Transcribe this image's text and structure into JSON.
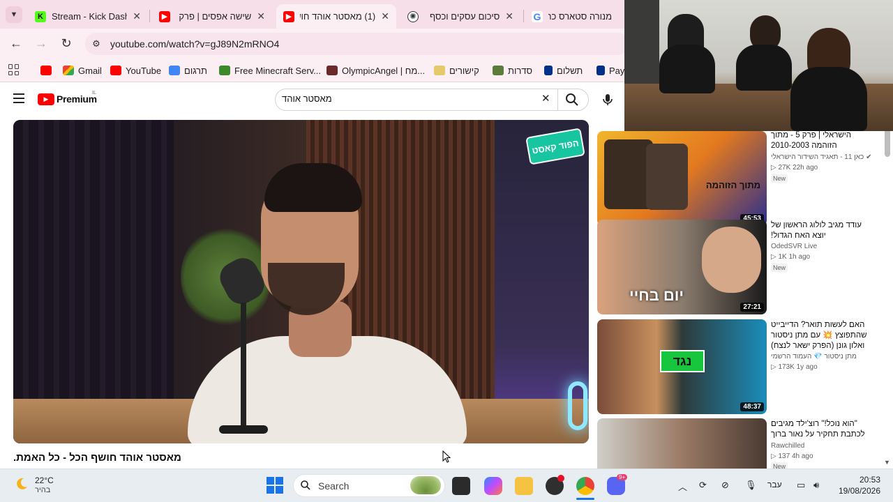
{
  "browser": {
    "tabs": [
      {
        "title": "Stream - Kick Dashb",
        "favicon": "kick-icon",
        "color": "#53fc18"
      },
      {
        "title": "שישה אפסים | פרק",
        "favicon": "youtube-icon",
        "color": "#ff0000"
      },
      {
        "title": "(1) מאסטר אוהד חוש",
        "favicon": "youtube-icon",
        "color": "#ff0000",
        "active": true
      },
      {
        "title": "סיכום עסקים וכסף",
        "favicon": "chatgpt-icon",
        "color": "#333333"
      },
      {
        "title": "מנורה סטארס כרטי",
        "favicon": "google-icon",
        "color": "#4285f4"
      }
    ],
    "url": "youtube.com/watch?v=gJ89N2mRNO4",
    "bookmarks": [
      {
        "label": "",
        "icon": "youtube-icon"
      },
      {
        "label": "Gmail",
        "icon": "gmail-icon"
      },
      {
        "label": "YouTube",
        "icon": "youtube-icon"
      },
      {
        "label": "תרגום",
        "icon": "translate-icon"
      },
      {
        "label": "Free Minecraft Serv...",
        "icon": "minecraft-icon"
      },
      {
        "label": "OlympicAngel | מח...",
        "icon": "avatar-icon"
      },
      {
        "label": "קישורים",
        "icon": "folder-icon"
      },
      {
        "label": "סדרות",
        "icon": "tv-icon"
      },
      {
        "label": "תשלום",
        "icon": "paypal-icon"
      },
      {
        "label": "Payl",
        "icon": "paypal-icon"
      }
    ]
  },
  "youtube": {
    "logo_text": "Premium",
    "logo_region": "IL",
    "search_value": "מאסטר אוהד",
    "video_title": "מאסטר אוהד חושף הכל - כל האמת.",
    "recommendations": [
      {
        "title": "הישראלי | פרק 5 - מתוך הזוהמה 2010-2003",
        "channel": "כאן 11 - תאגיד השידור הישראלי",
        "views": "27K",
        "age": "22h ago",
        "badge": "New",
        "duration": "45:53",
        "thumb_text": "מתוך הזוהמה"
      },
      {
        "title": "עודד מגיב לולוג הראשון של יוצא האח הגדול!",
        "channel": "OdedSVR Live",
        "views": "1K",
        "age": "1h ago",
        "badge": "New",
        "duration": "27:21",
        "thumb_text": "יום בחיי"
      },
      {
        "title": "האם לעשות תואר? הדייבייט שהתפוצץ 💥 עם מתן ניסטור ואלון גונן (הפרק ישאר לנצח)",
        "channel": "מתן ניסטור 💎 העמוד הרשמי",
        "views": "173K",
        "age": "1y ago",
        "badge": "",
        "duration": "48:37",
        "thumb_text": "נגד"
      },
      {
        "title": "\"הוא נוכל!\" רוצ'ילד מגיבים לכתבת תחקיר על נאור ברוך",
        "channel": "Rawchilled",
        "views": "137",
        "age": "4h ago",
        "badge": "New",
        "duration": "",
        "thumb_text": ""
      }
    ]
  },
  "taskbar": {
    "weather_temp": "22°C",
    "weather_desc": "בהיר",
    "search_placeholder": "Search",
    "language": "עבר",
    "time": "20:53",
    "date": "19/08/2026",
    "discord_badge": "9+"
  }
}
